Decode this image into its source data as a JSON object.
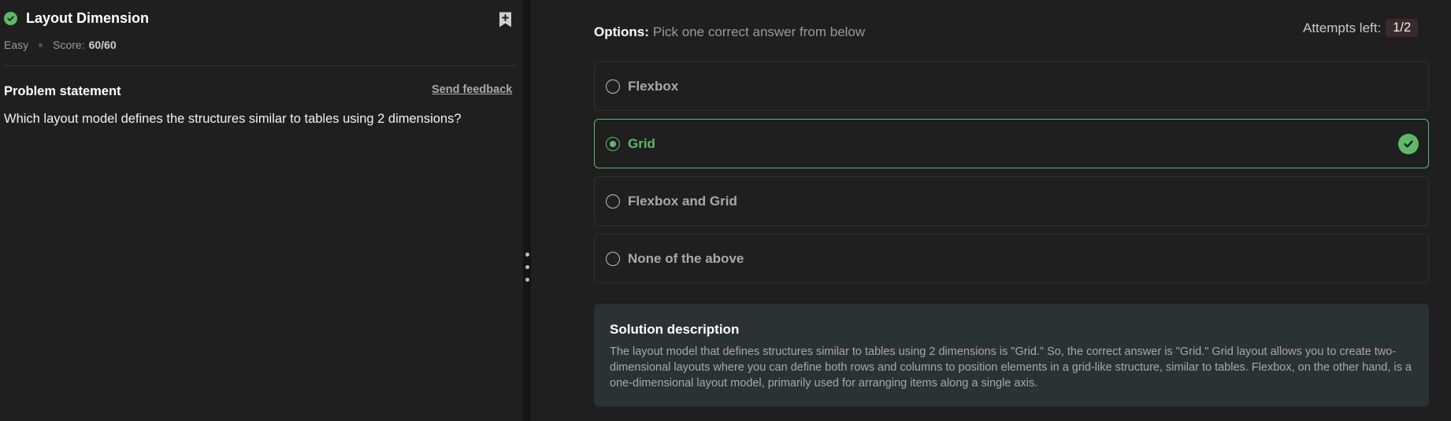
{
  "left": {
    "title": "Layout Dimension",
    "difficulty": "Easy",
    "score_label": "Score:",
    "score_value": "60/60",
    "problem_label": "Problem statement",
    "feedback_link": "Send feedback",
    "question": "Which layout model defines the structures similar to tables using 2 dimensions?"
  },
  "right": {
    "options_label": "Options:",
    "options_hint": "Pick one correct answer from below",
    "attempts_label": "Attempts left:",
    "attempts_value": "1/2",
    "options": [
      {
        "label": "Flexbox",
        "selected": false,
        "correct": false
      },
      {
        "label": "Grid",
        "selected": true,
        "correct": true
      },
      {
        "label": "Flexbox and Grid",
        "selected": false,
        "correct": false
      },
      {
        "label": "None of the above",
        "selected": false,
        "correct": false
      }
    ],
    "solution_title": "Solution description",
    "solution_text": "The layout model that defines structures similar to tables using 2 dimensions is \"Grid.\" So, the correct answer is \"Grid.\" Grid layout allows you to create two-dimensional layouts where you can define both rows and columns to position elements in a grid-like structure, similar to tables. Flexbox, on the other hand, is a one-dimensional layout model, primarily used for arranging items along a single axis."
  },
  "colors": {
    "accent_green": "#5fb869",
    "background": "#1f1f1f",
    "solution_bg": "#2b3233",
    "attempts_badge_bg": "#3b2a2c"
  },
  "icons": {
    "status": "check-circle-icon",
    "bookmark": "bookmark-add-icon",
    "correct": "check-circle-icon",
    "splitter": "drag-handle-icon"
  }
}
